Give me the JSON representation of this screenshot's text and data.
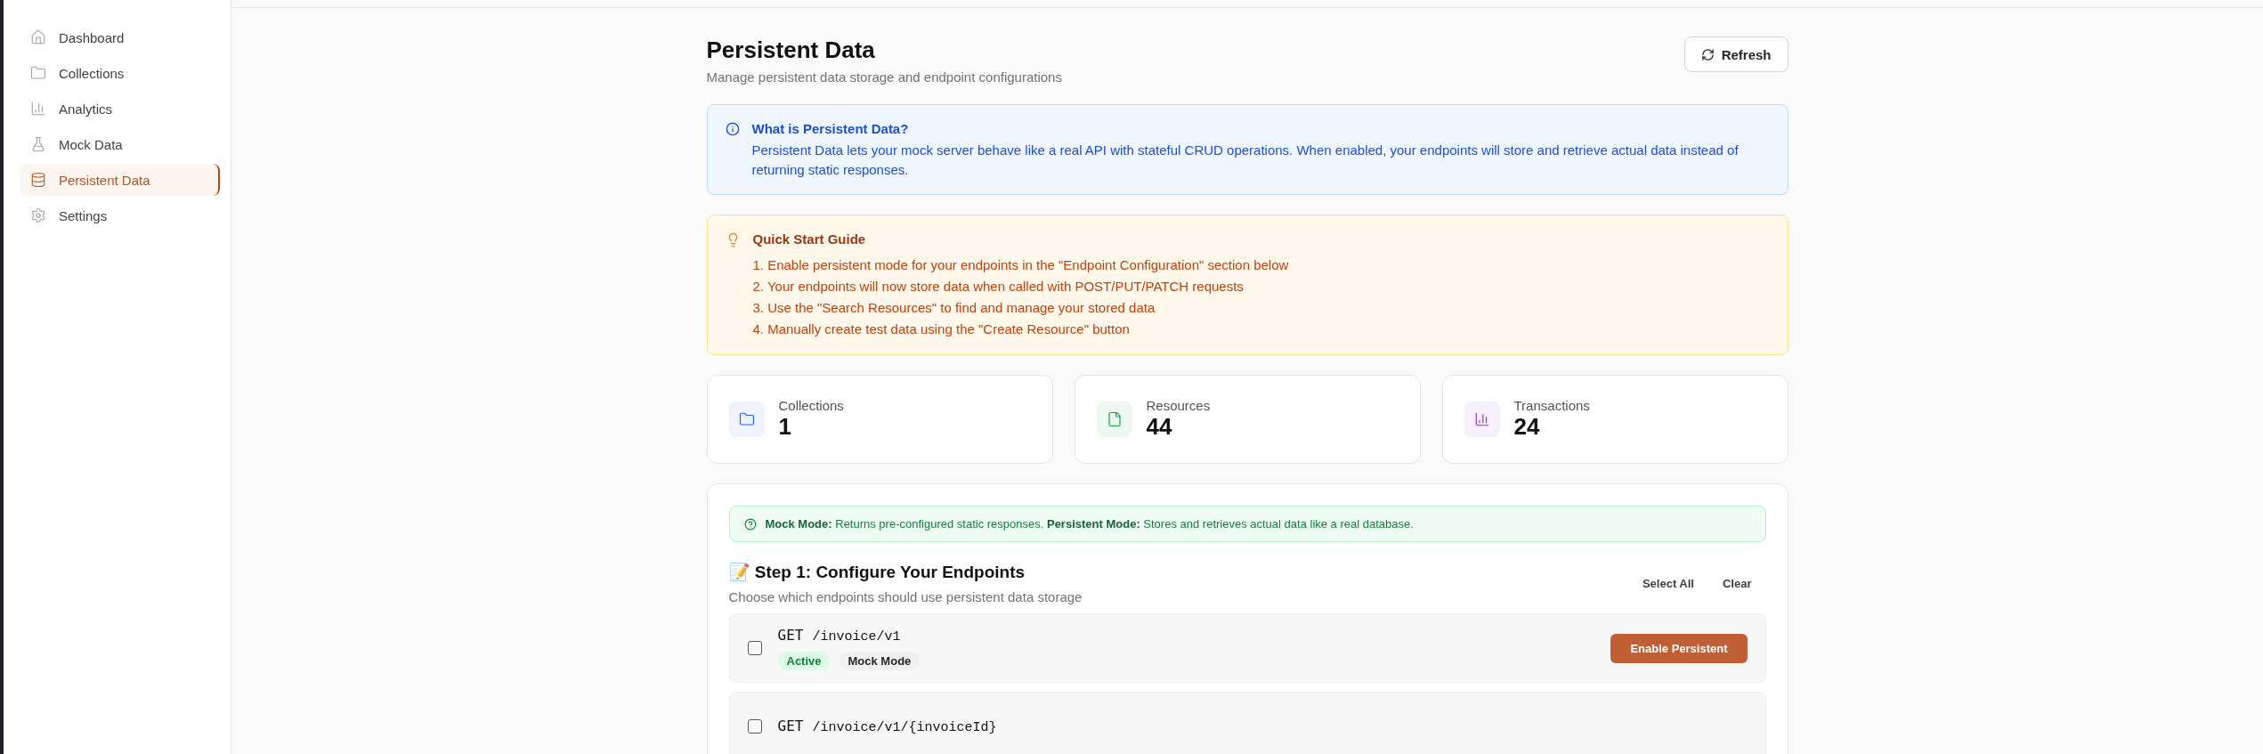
{
  "sidebar": {
    "items": [
      {
        "label": "Dashboard",
        "selected": false
      },
      {
        "label": "Collections",
        "selected": false
      },
      {
        "label": "Analytics",
        "selected": false
      },
      {
        "label": "Mock Data",
        "selected": false
      },
      {
        "label": "Persistent Data",
        "selected": true
      },
      {
        "label": "Settings",
        "selected": false
      }
    ]
  },
  "header": {
    "title": "Persistent Data",
    "subtitle": "Manage persistent data storage and endpoint configurations",
    "refresh_button": "Refresh"
  },
  "info_box": {
    "title": "What is Persistent Data?",
    "text": "Persistent Data lets your mock server behave like a real API with stateful CRUD operations. When enabled, your endpoints will store and retrieve actual data instead of returning static responses."
  },
  "quick_start": {
    "title": "Quick Start Guide",
    "steps": [
      "1. Enable persistent mode for your endpoints in the \"Endpoint Configuration\" section below",
      "2. Your endpoints will now store data when called with POST/PUT/PATCH requests",
      "3. Use the \"Search Resources\" to find and manage your stored data",
      "4. Manually create test data using the \"Create Resource\" button"
    ]
  },
  "stats": [
    {
      "label": "Collections",
      "value": "1",
      "color": "#2563eb"
    },
    {
      "label": "Resources",
      "value": "44",
      "color": "#16a34a"
    },
    {
      "label": "Transactions",
      "value": "24",
      "color": "#9333ea"
    }
  ],
  "endpoints_card": {
    "note": "**Mock Mode:** Returns pre-configured static responses.  **Persistent Mode:** Stores and retrieves actual data like a real database.",
    "title": "📝 Step 1: Configure Your Endpoints",
    "subtitle": "Choose which endpoints should use persistent data storage",
    "actions": [
      "Select All",
      "Clear"
    ],
    "endpoints": [
      {
        "method": "GET",
        "path": "/invoice/v1",
        "checked": false,
        "status": "Active",
        "mode": "Mock Mode",
        "button": "Enable Persistent"
      },
      {
        "method": "GET",
        "path": "/invoice/v1/{invoiceId}",
        "checked": false
      }
    ]
  }
}
